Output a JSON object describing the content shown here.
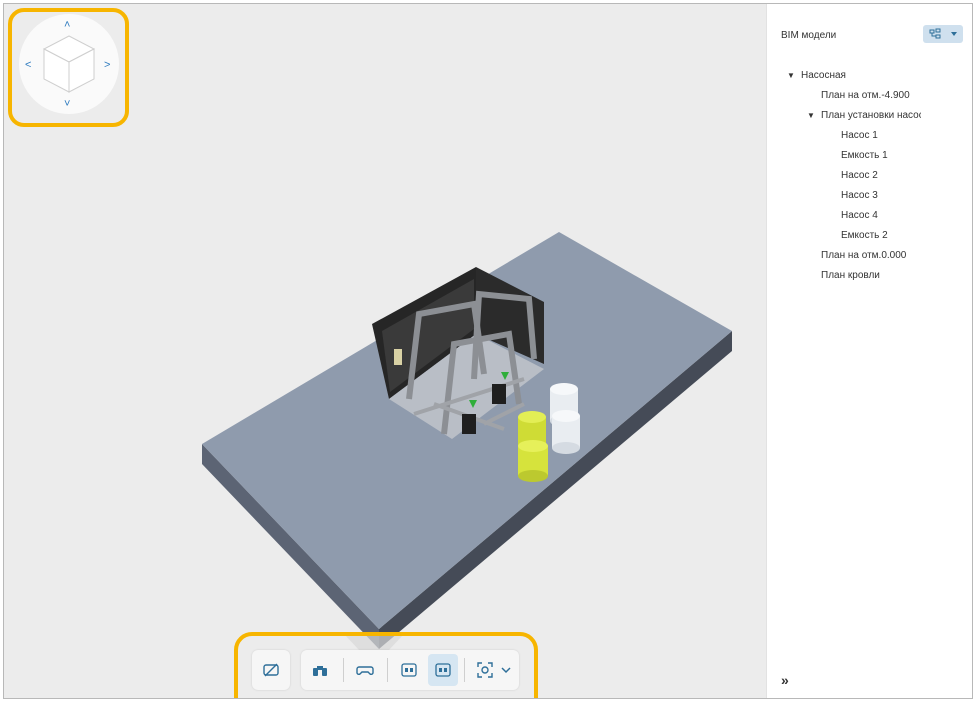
{
  "panel": {
    "title": "BIM модели",
    "collapse_glyph": "»",
    "tree": [
      {
        "label": "Насосная",
        "toggle": "▼"
      },
      {
        "label": "План на отм.-4.900"
      },
      {
        "label": "План установки насосов",
        "toggle": "▼"
      },
      {
        "label": "Насос 1"
      },
      {
        "label": "Емкость 1"
      },
      {
        "label": "Насос 2"
      },
      {
        "label": "Насос 3"
      },
      {
        "label": "Насос 4"
      },
      {
        "label": "Емкость 2"
      },
      {
        "label": "План на отм.0.000"
      },
      {
        "label": "План кровли"
      }
    ]
  },
  "navcube": {
    "arrows": [
      "˄",
      "˂",
      "˃",
      "˅"
    ]
  },
  "toolbar": {
    "icons": [
      "hide-markers-icon",
      "binoculars-icon",
      "gamepad-icon",
      "2d-view-icon",
      "3d-view-icon",
      "focus-frame-icon",
      "chevron-down-icon"
    ],
    "active": "3d-view-icon"
  },
  "colors": {
    "highlight": "#f7b500",
    "accent": "#2e7bbf",
    "active_button": "#d6e6f2",
    "slab": "#8f9bad",
    "tank_yellow": "#d6e33c"
  }
}
